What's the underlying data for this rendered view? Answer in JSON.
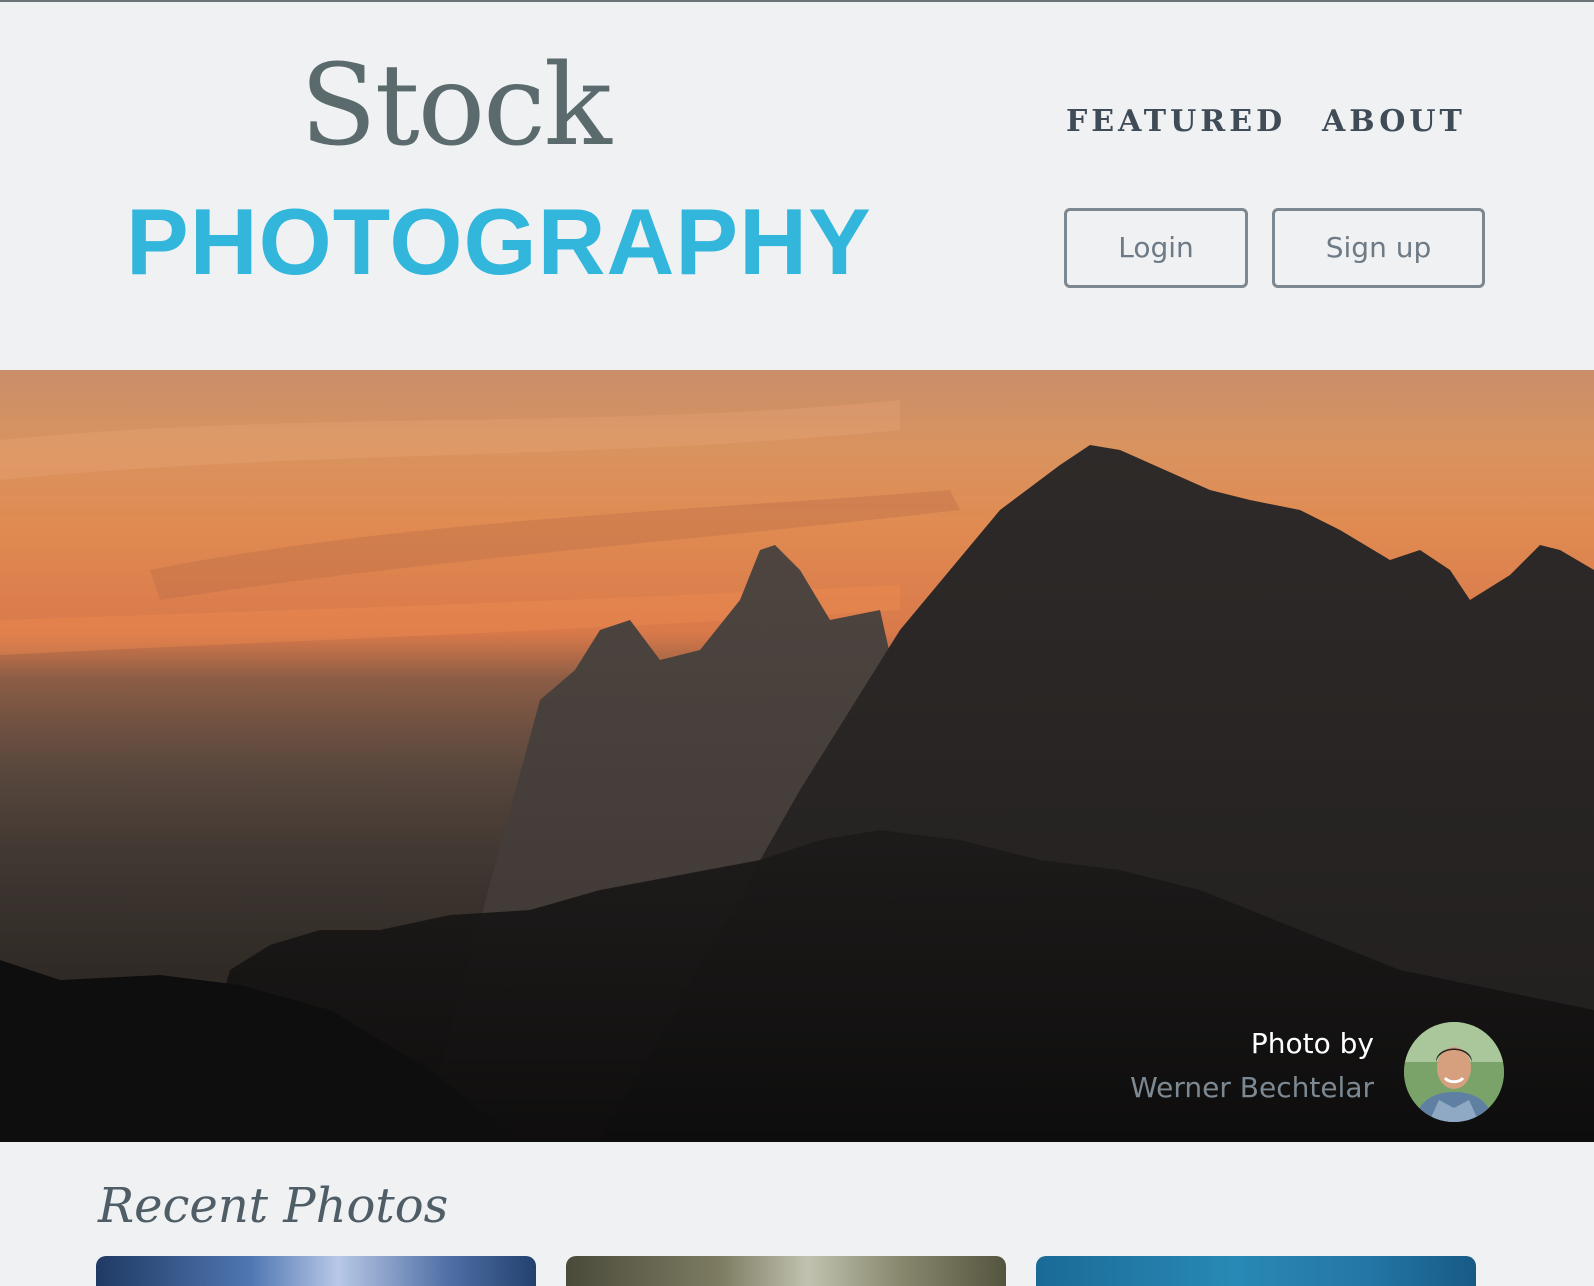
{
  "brand": {
    "line1": "Stock",
    "line2": "PHOTOGRAPHY",
    "accent_color": "#33b6db",
    "line1_color": "#5b6a6c"
  },
  "nav": {
    "items": [
      {
        "label": "FEATURED"
      },
      {
        "label": "ABOUT"
      }
    ]
  },
  "auth": {
    "login_label": "Login",
    "signup_label": "Sign up"
  },
  "hero": {
    "credit_prefix": "Photo by",
    "photographer": "Werner Bechtelar"
  },
  "recent": {
    "title": "Recent Photos"
  },
  "icons": {
    "avatar": "photographer-avatar"
  }
}
